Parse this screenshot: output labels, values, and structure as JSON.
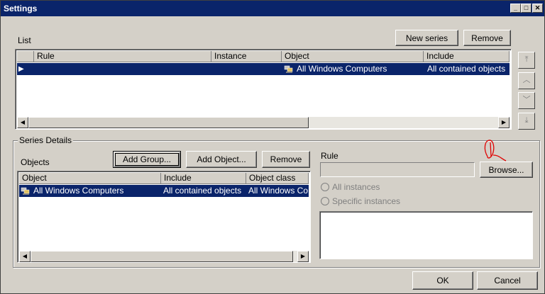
{
  "window": {
    "title": "Settings"
  },
  "list_section": {
    "label": "List",
    "new_series_label": "New series",
    "remove_label": "Remove",
    "columns": [
      "Rule",
      "Instance",
      "Object",
      "Include"
    ],
    "row": {
      "rule": "",
      "instance": "",
      "object": "All Windows Computers",
      "include": "All contained objects"
    }
  },
  "series_details": {
    "label": "Series Details",
    "objects_label": "Objects",
    "add_group_label": "Add Group...",
    "add_object_label": "Add Object...",
    "remove_label": "Remove",
    "columns": [
      "Object",
      "Include",
      "Object class"
    ],
    "row": {
      "object": "All Windows Computers",
      "include": "All contained objects",
      "object_class": "All Windows Co..."
    },
    "rule_label": "Rule",
    "rule_value": "",
    "browse_label": "Browse...",
    "all_instances_label": "All instances",
    "specific_instances_label": "Specific instances"
  },
  "footer": {
    "ok_label": "OK",
    "cancel_label": "Cancel"
  }
}
